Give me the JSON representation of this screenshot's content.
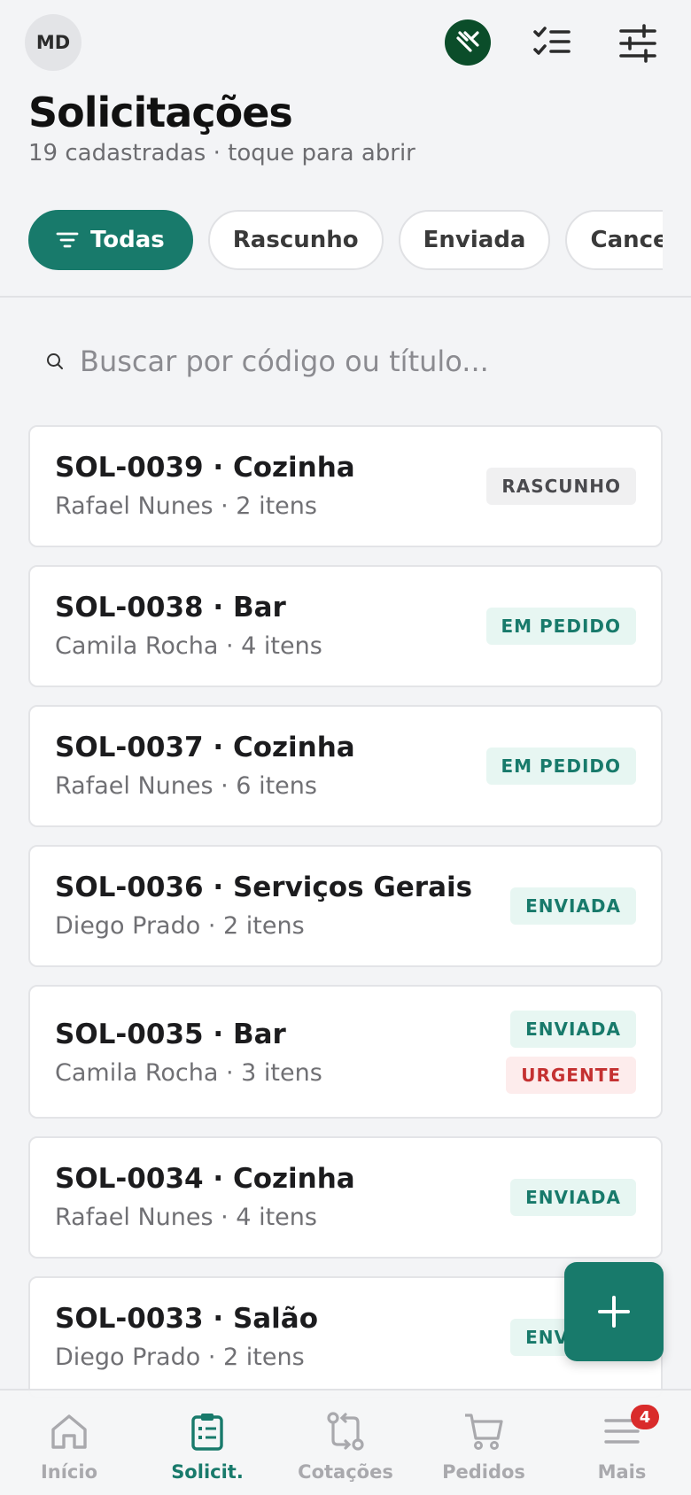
{
  "header": {
    "avatar_initials": "MD",
    "title": "Solicitações",
    "subtitle": "19 cadastradas · toque para abrir"
  },
  "filters": [
    {
      "label": "Todas",
      "active": true
    },
    {
      "label": "Rascunho",
      "active": false
    },
    {
      "label": "Enviada",
      "active": false
    },
    {
      "label": "Cancela",
      "active": false
    }
  ],
  "search": {
    "placeholder": "Buscar por código ou título..."
  },
  "requests": [
    {
      "title": "SOL-0039 · Cozinha",
      "subtitle": "Rafael Nunes · 2 itens",
      "badges": [
        {
          "label": "RASCUNHO",
          "tone": "gray"
        }
      ]
    },
    {
      "title": "SOL-0038 · Bar",
      "subtitle": "Camila Rocha · 4 itens",
      "badges": [
        {
          "label": "EM PEDIDO",
          "tone": "teal"
        }
      ]
    },
    {
      "title": "SOL-0037 · Cozinha",
      "subtitle": "Rafael Nunes · 6 itens",
      "badges": [
        {
          "label": "EM PEDIDO",
          "tone": "teal"
        }
      ]
    },
    {
      "title": "SOL-0036 · Serviços Gerais",
      "subtitle": "Diego Prado · 2 itens",
      "badges": [
        {
          "label": "ENVIADA",
          "tone": "teal"
        }
      ]
    },
    {
      "title": "SOL-0035 · Bar",
      "subtitle": "Camila Rocha · 3 itens",
      "badges": [
        {
          "label": "ENVIADA",
          "tone": "teal"
        },
        {
          "label": "URGENTE",
          "tone": "red"
        }
      ]
    },
    {
      "title": "SOL-0034 · Cozinha",
      "subtitle": "Rafael Nunes · 4 itens",
      "badges": [
        {
          "label": "ENVIADA",
          "tone": "teal"
        }
      ]
    },
    {
      "title": "SOL-0033 · Salão",
      "subtitle": "Diego Prado · 2 itens",
      "badges": [
        {
          "label": "ENVIADA",
          "tone": "teal"
        }
      ]
    }
  ],
  "bottom_nav": [
    {
      "label": "Início",
      "icon": "home-icon",
      "active": false
    },
    {
      "label": "Solicit.",
      "icon": "clipboard-list-icon",
      "active": true
    },
    {
      "label": "Cotações",
      "icon": "compare-arrows-icon",
      "active": false
    },
    {
      "label": "Pedidos",
      "icon": "cart-icon",
      "active": false
    },
    {
      "label": "Mais",
      "icon": "menu-icon",
      "active": false,
      "badge": "4"
    }
  ],
  "colors": {
    "accent": "#187a6b",
    "whatsapp_bg": "#0b4d2a",
    "badge_red": "#d92b2b",
    "background": "#f3f4f6"
  }
}
